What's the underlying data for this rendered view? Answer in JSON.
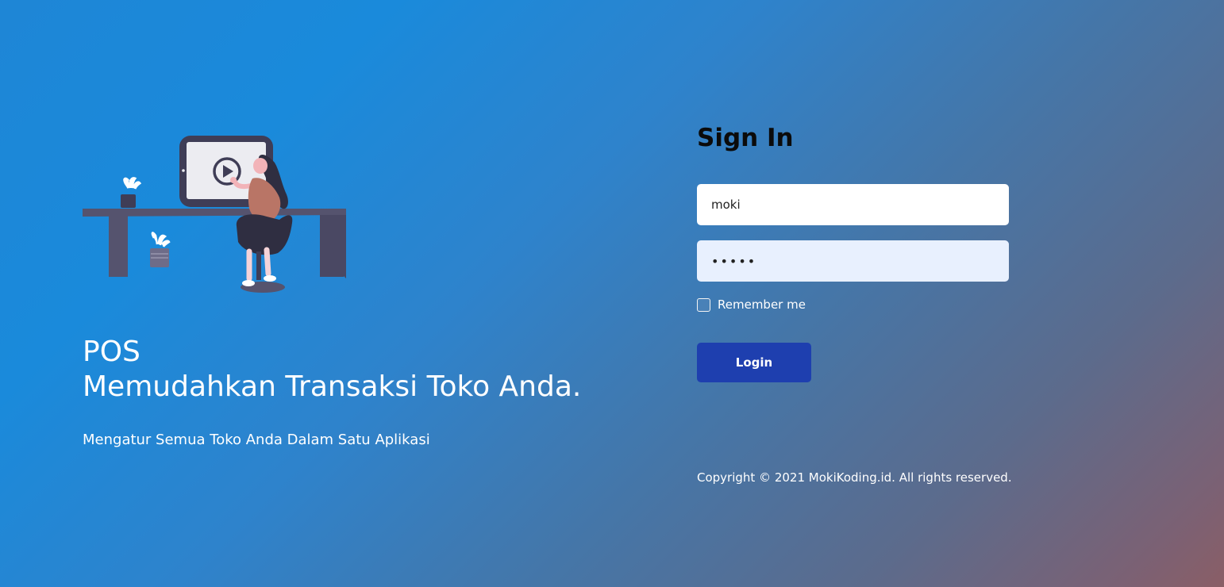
{
  "hero": {
    "illustration_icon": "woman-watching-video-illustration",
    "title_line1": "POS",
    "title_line2": "Memudahkan Transaksi Toko Anda.",
    "subtitle": "Mengatur Semua Toko Anda Dalam Satu Aplikasi"
  },
  "signin": {
    "title": "Sign In",
    "username_value": "moki",
    "password_value": "12345",
    "remember_label": "Remember me",
    "remember_checked": false,
    "login_label": "Login"
  },
  "footer": {
    "copyright": "Copyright © 2021 MokiKoding.id. All rights reserved."
  },
  "colors": {
    "button": "#1E3FAF",
    "password_field_bg": "#E8F0FE",
    "gradient_start": "#1E86D6",
    "gradient_end": "#8A5E66"
  }
}
